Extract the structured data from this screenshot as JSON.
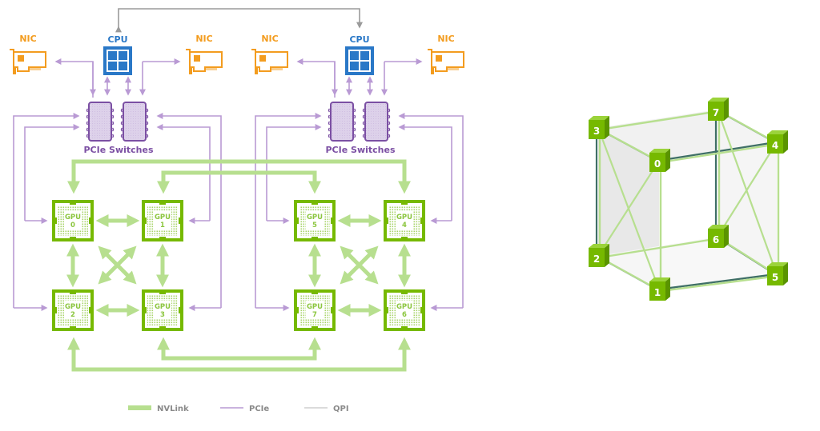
{
  "colors": {
    "nvlink": "#b7df8f",
    "pcie": "#b99ad4",
    "qpi": "#9a9a9a",
    "nic": "#f39c1f",
    "cpu": "#2a78c7",
    "gpu": "#76b900",
    "switch_fill": "#dcd0ea",
    "switch_stroke": "#7b4fa3",
    "cube_edge_dark": "#3f6f66",
    "cube_edge_light": "#b7df8f",
    "cube_node": "#76b900"
  },
  "labels": {
    "nic": "NIC",
    "cpu": "CPU",
    "pcie_switches": "PCIe Switches",
    "gpu": "GPU"
  },
  "left_board": {
    "nics": [
      "NIC",
      "NIC"
    ],
    "cpu": "CPU",
    "switches_label": "PCIe Switches",
    "gpus": [
      {
        "word": "GPU",
        "id": "0"
      },
      {
        "word": "GPU",
        "id": "1"
      },
      {
        "word": "GPU",
        "id": "2"
      },
      {
        "word": "GPU",
        "id": "3"
      }
    ]
  },
  "right_board": {
    "nics": [
      "NIC",
      "NIC"
    ],
    "cpu": "CPU",
    "switches_label": "PCIe Switches",
    "gpus": [
      {
        "word": "GPU",
        "id": "5"
      },
      {
        "word": "GPU",
        "id": "4"
      },
      {
        "word": "GPU",
        "id": "7"
      },
      {
        "word": "GPU",
        "id": "6"
      }
    ]
  },
  "legend": [
    {
      "label": "NVLink",
      "kind": "nvlink"
    },
    {
      "label": "PCIe",
      "kind": "pcie"
    },
    {
      "label": "QPI",
      "kind": "qpi"
    }
  ],
  "cube": {
    "nodes": [
      "0",
      "1",
      "2",
      "3",
      "4",
      "5",
      "6",
      "7"
    ]
  }
}
